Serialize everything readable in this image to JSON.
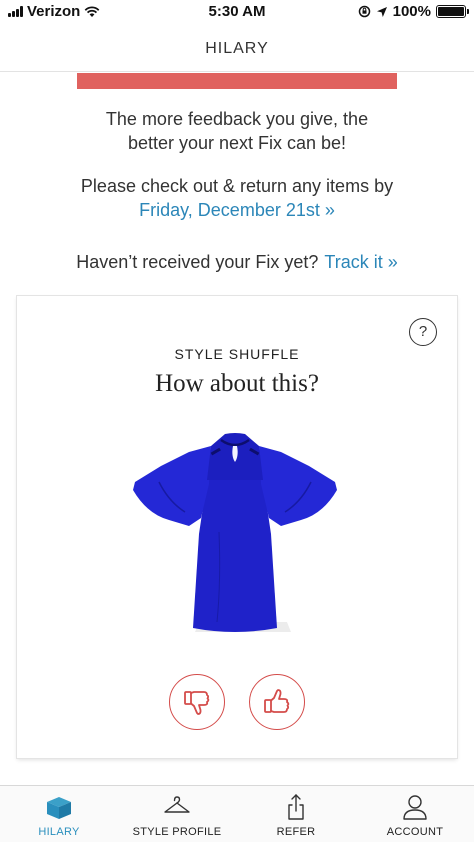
{
  "status_bar": {
    "carrier": "Verizon",
    "time": "5:30 AM",
    "battery": "100%",
    "battery_level": 1.0,
    "icons": [
      "signal-icon",
      "wifi-icon",
      "rotation-lock-icon",
      "location-icon",
      "battery-icon"
    ]
  },
  "nav": {
    "title": "HILARY"
  },
  "banner": {
    "color": "#e0625f"
  },
  "messages": {
    "feedback_line1": "The more feedback you give, the",
    "feedback_line2": "better your next Fix can be!",
    "return_prompt": "Please check out & return any items by",
    "return_date": "Friday, December 21st »",
    "not_received": "Haven’t received your Fix yet?",
    "track_link": "Track it »"
  },
  "style_shuffle": {
    "eyebrow": "STYLE SHUFFLE",
    "heading": "How about this?",
    "help_label": "?",
    "product_icon": "blouse-image",
    "dislike_icon": "thumbs-down-icon",
    "like_icon": "thumbs-up-icon"
  },
  "tabs": [
    {
      "label": "HILARY",
      "icon": "box-icon",
      "active": true
    },
    {
      "label": "STYLE PROFILE",
      "icon": "hanger-icon",
      "active": false
    },
    {
      "label": "REFER",
      "icon": "share-icon",
      "active": false
    },
    {
      "label": "ACCOUNT",
      "icon": "person-icon",
      "active": false
    }
  ],
  "colors": {
    "accent_link": "#2b86b8",
    "banner": "#e0625f",
    "vote_outline": "#d44c4a",
    "tab_active": "#2a8fbd",
    "product_blue": "#1f22c9"
  }
}
